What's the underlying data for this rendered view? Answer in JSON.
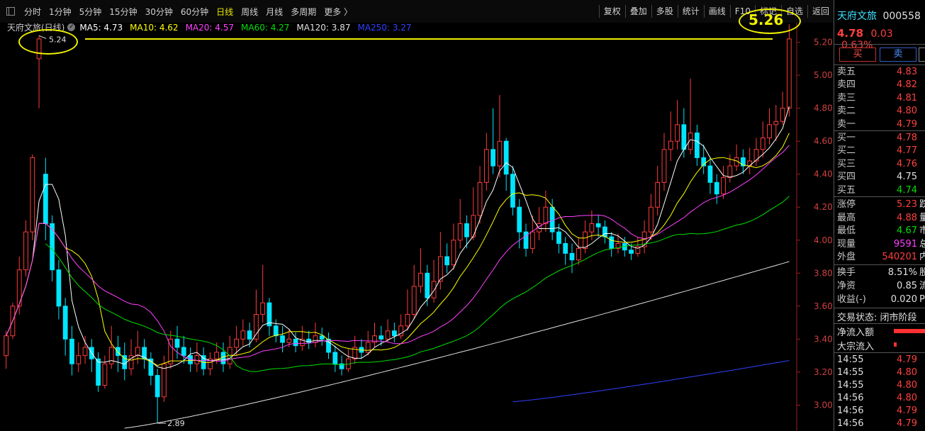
{
  "toolbar": {
    "periods": [
      "分时",
      "1分钟",
      "5分钟",
      "15分钟",
      "30分钟",
      "60分钟",
      "日线",
      "周线",
      "月线",
      "多周期",
      "更多 〉"
    ],
    "active_period": "日线",
    "right_buttons": [
      "复权",
      "叠加",
      "多股",
      "统计",
      "画线",
      "F10",
      "标记",
      "自选",
      "返回"
    ]
  },
  "legend": {
    "stock_label": "天府文旅(日线)",
    "ma5": "MA5: 4.73",
    "ma10": "MA10: 4.62",
    "ma20": "MA20: 4.57",
    "ma60": "MA60: 4.27",
    "ma120": "MA120: 3.87",
    "ma250": "MA250: 3.27"
  },
  "colors": {
    "up": "#ff3b3b",
    "down": "#00e5ff",
    "ma5": "#ffffff",
    "ma10": "#ffff00",
    "ma20": "#ff40ff",
    "ma60": "#00e000",
    "ma120": "#e0e0e0",
    "ma250": "#3040ff",
    "annotation": "#f0f000"
  },
  "chart_data": {
    "type": "candlestick",
    "y_ticks": [
      "5.20",
      "5.00",
      "4.80",
      "4.60",
      "4.40",
      "4.20",
      "4.00",
      "3.80",
      "3.60",
      "3.40",
      "3.20",
      "3.00"
    ],
    "ylim": [
      2.86,
      5.31
    ],
    "high_marker": "5.24",
    "low_marker": "2.89",
    "annotation_price": "5.26",
    "candles": [
      [
        3.3,
        3.42,
        3.45,
        3.22
      ],
      [
        3.42,
        3.6,
        3.62,
        3.4
      ],
      [
        3.6,
        3.82,
        3.9,
        3.55
      ],
      [
        3.82,
        4.05,
        4.12,
        3.78
      ],
      [
        4.05,
        4.5,
        4.52,
        4.0
      ],
      [
        5.1,
        5.22,
        5.24,
        4.8
      ],
      [
        4.4,
        4.1,
        4.5,
        4.0
      ],
      [
        4.1,
        3.82,
        4.15,
        3.75
      ],
      [
        3.82,
        3.6,
        3.88,
        3.52
      ],
      [
        3.6,
        3.4,
        3.65,
        3.3
      ],
      [
        3.4,
        3.25,
        3.48,
        3.18
      ],
      [
        3.25,
        3.3,
        3.38,
        3.2
      ],
      [
        3.3,
        3.35,
        3.42,
        3.25
      ],
      [
        3.35,
        3.28,
        3.4,
        3.2
      ],
      [
        3.28,
        3.12,
        3.32,
        3.08
      ],
      [
        3.12,
        3.25,
        3.3,
        3.1
      ],
      [
        3.25,
        3.35,
        3.48,
        3.22
      ],
      [
        3.35,
        3.3,
        3.42,
        3.2
      ],
      [
        3.3,
        3.22,
        3.38,
        3.15
      ],
      [
        3.22,
        3.3,
        3.4,
        3.18
      ],
      [
        3.3,
        3.35,
        3.45,
        3.25
      ],
      [
        3.35,
        3.28,
        3.4,
        3.22
      ],
      [
        3.28,
        3.18,
        3.32,
        3.12
      ],
      [
        3.18,
        3.05,
        3.22,
        2.89
      ],
      [
        3.05,
        3.25,
        3.3,
        3.02
      ],
      [
        3.25,
        3.4,
        3.45,
        3.22
      ],
      [
        3.4,
        3.35,
        3.48,
        3.28
      ],
      [
        3.35,
        3.3,
        3.42,
        3.25
      ],
      [
        3.3,
        3.25,
        3.35,
        3.2
      ],
      [
        3.25,
        3.3,
        3.38,
        3.2
      ],
      [
        3.3,
        3.22,
        3.35,
        3.18
      ],
      [
        3.22,
        3.28,
        3.32,
        3.18
      ],
      [
        3.28,
        3.32,
        3.38,
        3.25
      ],
      [
        3.32,
        3.25,
        3.38,
        3.2
      ],
      [
        3.25,
        3.35,
        3.42,
        3.22
      ],
      [
        3.35,
        3.4,
        3.48,
        3.3
      ],
      [
        3.4,
        3.45,
        3.52,
        3.36
      ],
      [
        3.45,
        3.4,
        3.5,
        3.35
      ],
      [
        3.4,
        3.55,
        3.7,
        3.38
      ],
      [
        3.55,
        3.62,
        3.85,
        3.5
      ],
      [
        3.62,
        3.48,
        3.65,
        3.42
      ],
      [
        3.48,
        3.42,
        3.52,
        3.38
      ],
      [
        3.42,
        3.38,
        3.48,
        3.32
      ],
      [
        3.38,
        3.4,
        3.46,
        3.35
      ],
      [
        3.4,
        3.36,
        3.44,
        3.32
      ],
      [
        3.36,
        3.4,
        3.48,
        3.33
      ],
      [
        3.4,
        3.38,
        3.45,
        3.34
      ],
      [
        3.38,
        3.42,
        3.5,
        3.35
      ],
      [
        3.42,
        3.4,
        3.47,
        3.36
      ],
      [
        3.4,
        3.32,
        3.44,
        3.28
      ],
      [
        3.32,
        3.25,
        3.36,
        3.2
      ],
      [
        3.25,
        3.22,
        3.3,
        3.18
      ],
      [
        3.22,
        3.28,
        3.34,
        3.2
      ],
      [
        3.28,
        3.35,
        3.42,
        3.25
      ],
      [
        3.35,
        3.32,
        3.4,
        3.28
      ],
      [
        3.32,
        3.38,
        3.45,
        3.3
      ],
      [
        3.38,
        3.42,
        3.5,
        3.35
      ],
      [
        3.42,
        3.4,
        3.48,
        3.36
      ],
      [
        3.4,
        3.45,
        3.52,
        3.38
      ],
      [
        3.45,
        3.42,
        3.5,
        3.38
      ],
      [
        3.42,
        3.48,
        3.55,
        3.4
      ],
      [
        3.48,
        3.55,
        3.7,
        3.45
      ],
      [
        3.55,
        3.72,
        3.85,
        3.52
      ],
      [
        3.72,
        3.8,
        3.95,
        3.68
      ],
      [
        3.8,
        3.65,
        3.85,
        3.6
      ],
      [
        3.65,
        3.75,
        3.88,
        3.62
      ],
      [
        3.75,
        3.9,
        4.05,
        3.7
      ],
      [
        3.9,
        3.85,
        3.98,
        3.8
      ],
      [
        3.85,
        4.0,
        4.1,
        3.82
      ],
      [
        4.0,
        4.1,
        4.25,
        3.95
      ],
      [
        4.1,
        4.02,
        4.15,
        3.95
      ],
      [
        4.02,
        4.15,
        4.32,
        4.0
      ],
      [
        4.15,
        4.35,
        4.45,
        4.1
      ],
      [
        4.35,
        4.55,
        4.65,
        4.3
      ],
      [
        4.55,
        4.45,
        4.8,
        4.4
      ],
      [
        4.45,
        4.6,
        4.88,
        4.38
      ],
      [
        4.6,
        4.4,
        4.62,
        4.3
      ],
      [
        4.4,
        4.2,
        4.45,
        4.15
      ],
      [
        4.2,
        4.05,
        4.25,
        3.95
      ],
      [
        4.05,
        3.95,
        4.1,
        3.9
      ],
      [
        3.95,
        4.05,
        4.15,
        3.92
      ],
      [
        4.05,
        4.1,
        4.2,
        4.0
      ],
      [
        4.1,
        4.2,
        4.3,
        4.05
      ],
      [
        4.2,
        4.05,
        4.25,
        4.0
      ],
      [
        4.05,
        3.98,
        4.1,
        3.92
      ],
      [
        3.98,
        3.92,
        4.02,
        3.85
      ],
      [
        3.92,
        3.88,
        3.98,
        3.8
      ],
      [
        3.88,
        3.95,
        4.02,
        3.85
      ],
      [
        3.95,
        4.05,
        4.12,
        3.92
      ],
      [
        4.05,
        4.1,
        4.18,
        4.0
      ],
      [
        4.1,
        4.08,
        4.15,
        4.02
      ],
      [
        4.08,
        4.02,
        4.12,
        3.98
      ],
      [
        4.02,
        3.95,
        4.05,
        3.9
      ],
      [
        3.95,
        3.98,
        4.04,
        3.92
      ],
      [
        3.98,
        3.94,
        4.02,
        3.9
      ],
      [
        3.94,
        3.92,
        3.98,
        3.88
      ],
      [
        3.92,
        3.96,
        4.02,
        3.9
      ],
      [
        3.96,
        4.05,
        4.12,
        3.92
      ],
      [
        4.05,
        4.2,
        4.28,
        4.0
      ],
      [
        4.2,
        4.35,
        4.45,
        4.15
      ],
      [
        4.35,
        4.55,
        4.65,
        4.3
      ],
      [
        4.55,
        4.6,
        4.78,
        4.48
      ],
      [
        4.6,
        4.7,
        4.85,
        4.55
      ],
      [
        4.7,
        4.55,
        4.8,
        4.5
      ],
      [
        4.55,
        4.65,
        4.98,
        4.52
      ],
      [
        4.65,
        4.5,
        4.7,
        4.45
      ],
      [
        4.5,
        4.45,
        4.58,
        4.4
      ],
      [
        4.45,
        4.35,
        4.5,
        4.28
      ],
      [
        4.35,
        4.28,
        4.4,
        4.22
      ],
      [
        4.28,
        4.38,
        4.45,
        4.25
      ],
      [
        4.38,
        4.45,
        4.52,
        4.35
      ],
      [
        4.45,
        4.5,
        4.58,
        4.42
      ],
      [
        4.5,
        4.45,
        4.55,
        4.4
      ],
      [
        4.45,
        4.48,
        4.56,
        4.4
      ],
      [
        4.48,
        4.55,
        4.62,
        4.45
      ],
      [
        4.55,
        4.62,
        4.72,
        4.5
      ],
      [
        4.62,
        4.7,
        4.8,
        4.58
      ],
      [
        4.7,
        4.72,
        4.82,
        4.6
      ],
      [
        4.72,
        4.8,
        4.9,
        4.7
      ],
      [
        4.8,
        5.22,
        5.31,
        4.75
      ]
    ]
  },
  "sidebar": {
    "name": "天府文旅",
    "code": "000558",
    "price": "4.78",
    "change": "0.03",
    "pct": "0.63%",
    "buy_label": "买",
    "sell_label": "卖",
    "asks": [
      {
        "label": "卖五",
        "value": "4.83"
      },
      {
        "label": "卖四",
        "value": "4.82"
      },
      {
        "label": "卖三",
        "value": "4.81"
      },
      {
        "label": "卖二",
        "value": "4.80"
      },
      {
        "label": "卖一",
        "value": "4.79"
      }
    ],
    "bids": [
      {
        "label": "买一",
        "value": "4.78"
      },
      {
        "label": "买二",
        "value": "4.77"
      },
      {
        "label": "买三",
        "value": "4.76"
      },
      {
        "label": "买四",
        "value": "4.75"
      },
      {
        "label": "买五",
        "value": "4.74"
      }
    ],
    "stats": [
      {
        "label": "涨停",
        "value": "5.23",
        "suffix": "跌"
      },
      {
        "label": "最高",
        "value": "4.88",
        "suffix": "量"
      },
      {
        "label": "最低",
        "value": "4.67",
        "suffix": "市"
      },
      {
        "label": "现量",
        "value": "9591",
        "suffix": "总"
      },
      {
        "label": "外盘",
        "value": "540201",
        "suffix": "内"
      }
    ],
    "stats2": [
      {
        "label": "换手",
        "value": "8.51%",
        "suffix": "股"
      },
      {
        "label": "净资",
        "value": "0.85",
        "suffix": "流"
      },
      {
        "label": "收益(-)",
        "value": "0.020",
        "suffix": "P"
      }
    ],
    "trade_status": "交易状态: 闭市阶段",
    "net_flow_label": "净流入额",
    "block_flow_label": "大宗流入",
    "ticks": [
      {
        "time": "14:55",
        "price": "4.79"
      },
      {
        "time": "14:55",
        "price": "4.80"
      },
      {
        "time": "14:55",
        "price": "4.80"
      },
      {
        "time": "14:56",
        "price": "4.80"
      },
      {
        "time": "14:56",
        "price": "4.79"
      },
      {
        "time": "14:56",
        "price": "4.79"
      }
    ]
  }
}
